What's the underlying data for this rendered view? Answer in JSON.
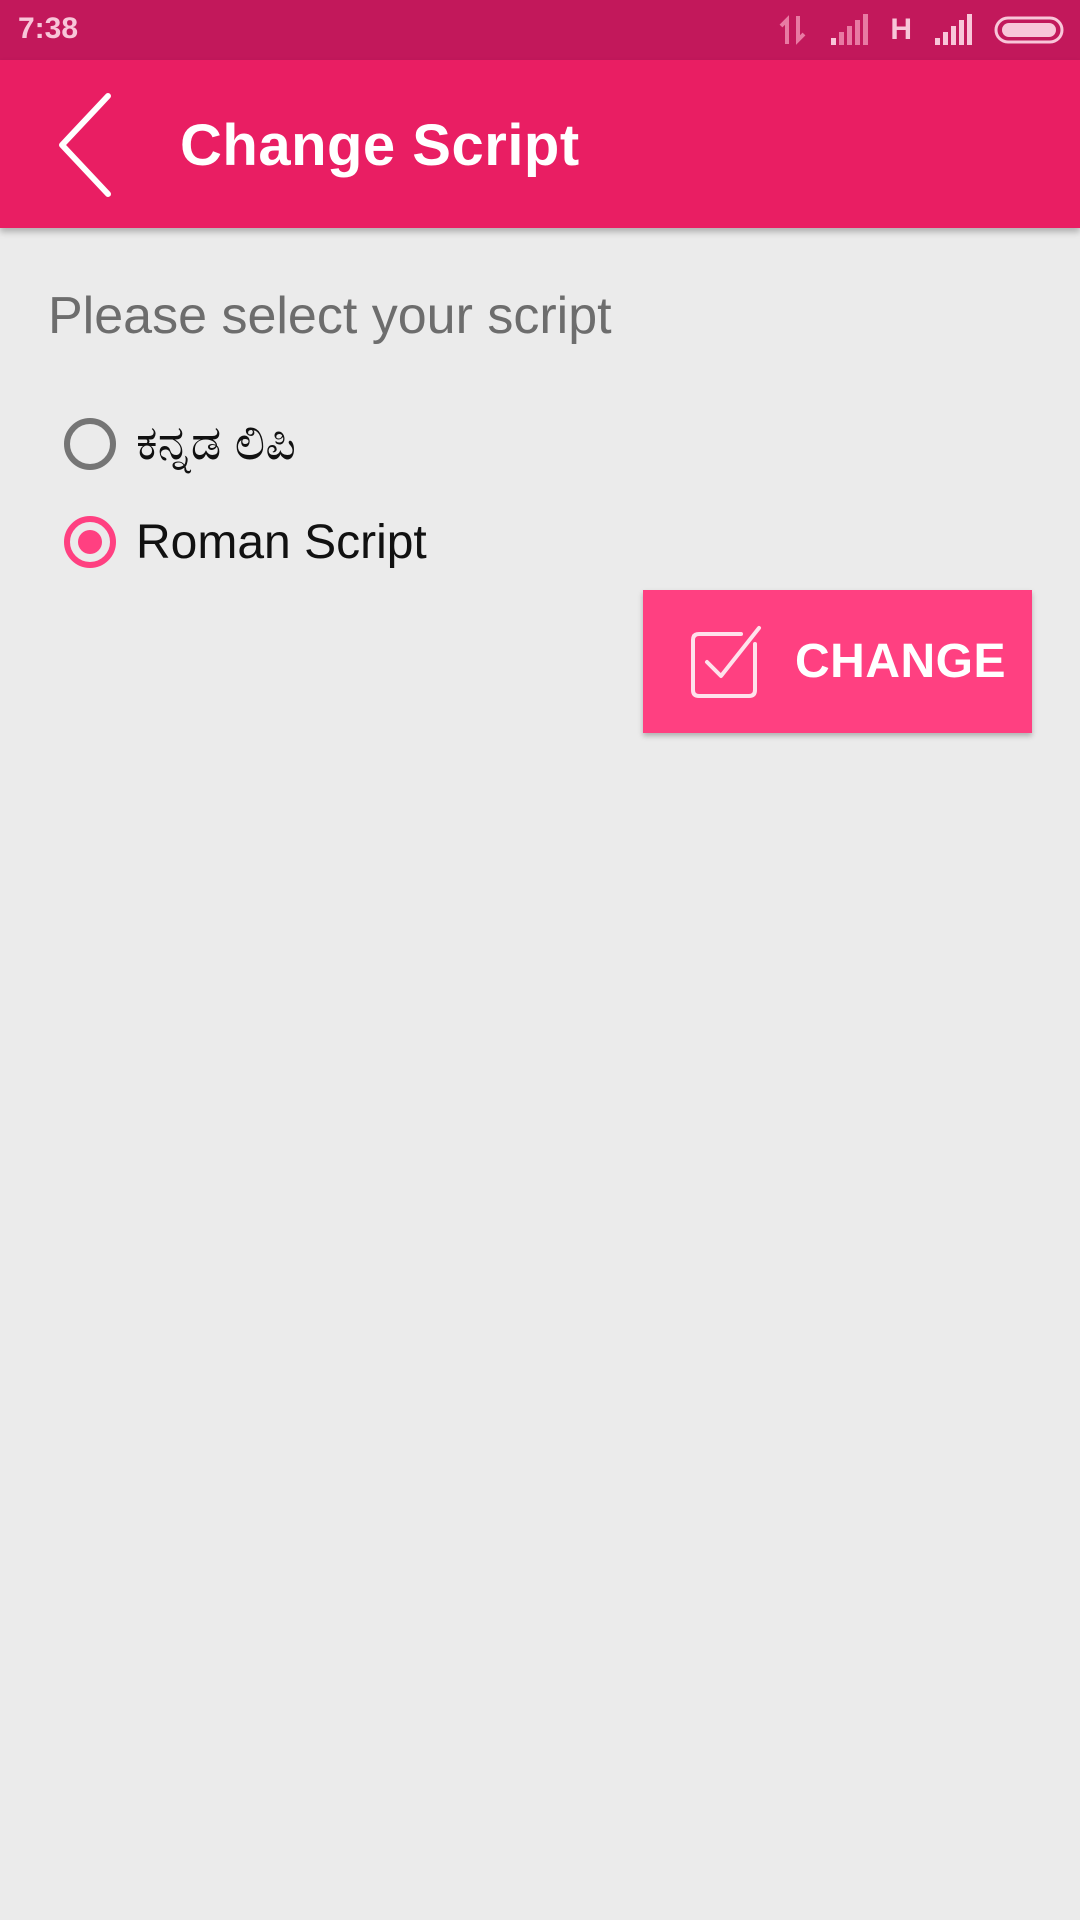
{
  "status_bar": {
    "time": "7:38",
    "network_type": "H"
  },
  "app_bar": {
    "title": "Change Script"
  },
  "content": {
    "prompt": "Please select your script",
    "options": [
      {
        "label": "ಕನ್ನಡ ಲಿಪಿ",
        "selected": false
      },
      {
        "label": "Roman Script",
        "selected": true
      }
    ],
    "change_button_label": "CHANGE"
  },
  "colors": {
    "status_bar": "#c2185b",
    "app_bar": "#e91e63",
    "accent": "#ff4081",
    "background": "#ebebeb"
  },
  "icons": {
    "back": "back-arrow-icon",
    "data_activity": "data-activity-icon",
    "signal_1": "signal-weak-icon",
    "signal_2": "signal-full-icon",
    "battery": "battery-icon",
    "change": "checkbox-checked-icon"
  }
}
